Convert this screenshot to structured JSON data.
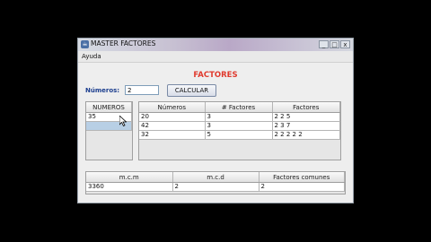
{
  "window": {
    "title": "MASTER FACTORES",
    "app_icon": "java-cup-icon",
    "minimize": "_",
    "maximize": "□",
    "close": "x"
  },
  "menu": {
    "items": [
      "Ayuda"
    ]
  },
  "heading": "FACTORES",
  "form": {
    "numeros_label": "Números:",
    "numeros_value": "2",
    "calcular_label": "CALCULAR"
  },
  "numeros_list": {
    "header": "NUMEROS",
    "rows": [
      "35",
      ""
    ]
  },
  "factors_table": {
    "headers": [
      "Números",
      "# Factores",
      "Factores"
    ],
    "rows": [
      [
        "20",
        "3",
        "2  2  5"
      ],
      [
        "42",
        "3",
        "2  3  7"
      ],
      [
        "32",
        "5",
        "2  2  2  2  2"
      ]
    ]
  },
  "results_table": {
    "headers": [
      "m.c.m",
      "m.c.d",
      "Factores comunes"
    ],
    "rows": [
      [
        "3360",
        "2",
        "2"
      ]
    ]
  },
  "colors": {
    "heading": "#e03a2e",
    "label": "#1d3f8f",
    "selection": "#b8cfe5"
  }
}
